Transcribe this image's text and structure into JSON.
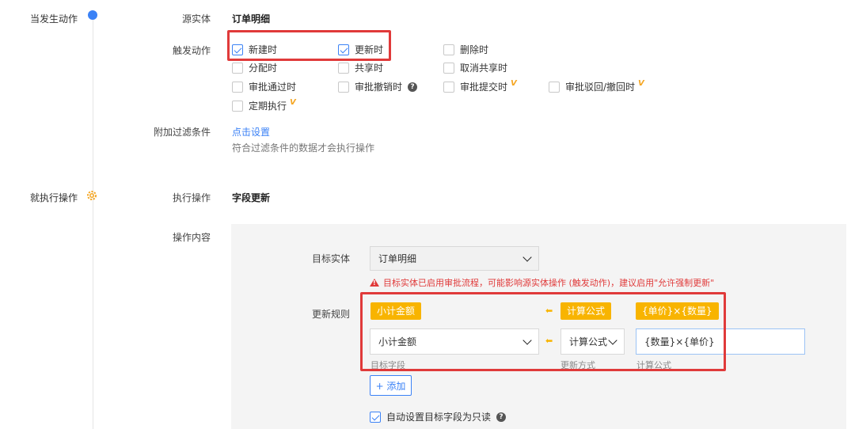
{
  "trigger": {
    "step_label": "当发生动作",
    "source_entity_label": "源实体",
    "source_entity_value": "订单明细",
    "action_label": "触发动作",
    "actions": {
      "create": "新建时",
      "update": "更新时",
      "delete": "删除时",
      "assign": "分配时",
      "share": "共享时",
      "unshare": "取消共享时",
      "approve": "审批通过时",
      "revoke": "审批撤销时",
      "submit": "审批提交时",
      "reject": "审批驳回/撤回时",
      "schedule": "定期执行"
    },
    "version_mark": "V",
    "help_mark": "?",
    "filter_label": "附加过滤条件",
    "filter_link": "点击设置",
    "filter_hint": "符合过滤条件的数据才会执行操作"
  },
  "execute": {
    "step_label": "就执行操作",
    "action_label": "执行操作",
    "action_value": "字段更新",
    "content_label": "操作内容",
    "target_entity_label": "目标实体",
    "target_entity_value": "订单明细",
    "warning": "目标实体已启用审批流程，可能影响源实体操作 (触发动作)，建议启用\"允许强制更新\"",
    "rules_label": "更新规则",
    "rule": {
      "tag_field": "小计金额",
      "tag_method": "计算公式",
      "tag_formula": "{单价}×{数量}",
      "field_value": "小计金额",
      "method_value": "计算公式",
      "formula_value": "{数量}×{单价}",
      "field_caption": "目标字段",
      "method_caption": "更新方式",
      "formula_caption": "计算公式"
    },
    "add_button": "+ 添加",
    "readonly_label": "自动设置目标字段为只读"
  },
  "colors": {
    "accent": "#3b82f6",
    "tag": "#f8b400",
    "highlight": "#e03a3a"
  }
}
